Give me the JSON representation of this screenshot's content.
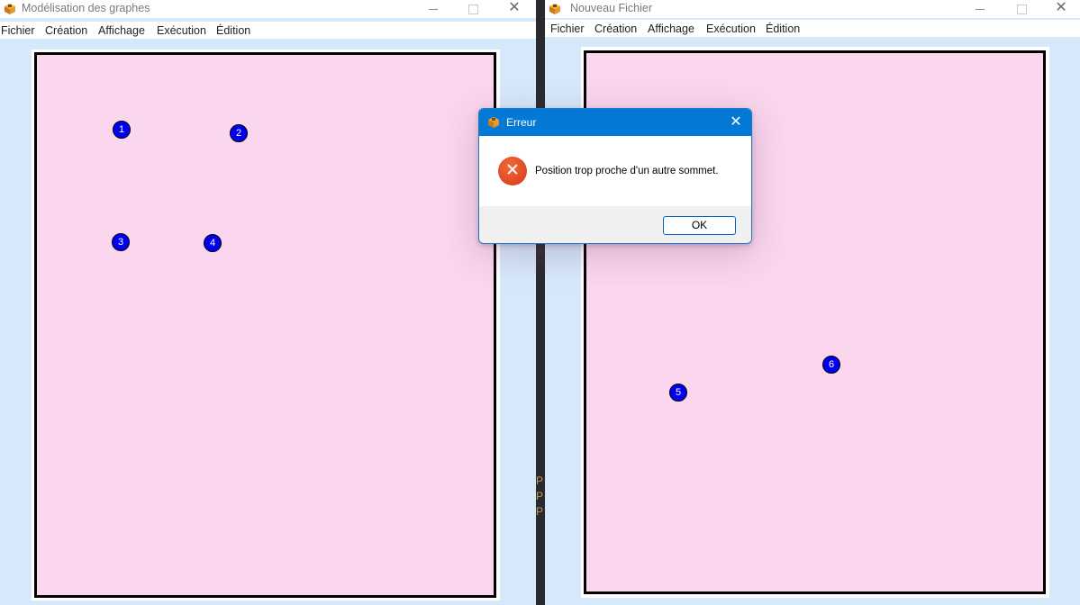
{
  "left_window": {
    "title": "Modélisation des graphes",
    "controls": {
      "minimize": "—",
      "maximize": "☐",
      "close": "✕"
    },
    "menu": [
      "Fichier",
      "Création",
      "Affichage",
      "Exécution",
      "Édition"
    ],
    "vertices": [
      {
        "label": "1"
      },
      {
        "label": "2"
      },
      {
        "label": "3"
      },
      {
        "label": "4"
      }
    ]
  },
  "right_window": {
    "title": "Nouveau Fichier",
    "controls": {
      "minimize": "—",
      "maximize": "☐",
      "close": "✕"
    },
    "menu": [
      "Fichier",
      "Création",
      "Affichage",
      "Exécution",
      "Édition"
    ],
    "vertices": [
      {
        "label": "5"
      },
      {
        "label": "6"
      }
    ]
  },
  "background_fragments": [
    "P",
    "P",
    "P"
  ],
  "dialog": {
    "title": "Erreur",
    "close_label": "✕",
    "error_icon": "✕",
    "message": "Position trop proche d'un autre sommet.",
    "ok_label": "OK"
  },
  "colors": {
    "window_bg": "#d6e9fa",
    "canvas_bg": "#fad7ee",
    "vertex": "#0000ee",
    "dialog_title": "#0378d5",
    "error_icon": "#e0461f"
  }
}
